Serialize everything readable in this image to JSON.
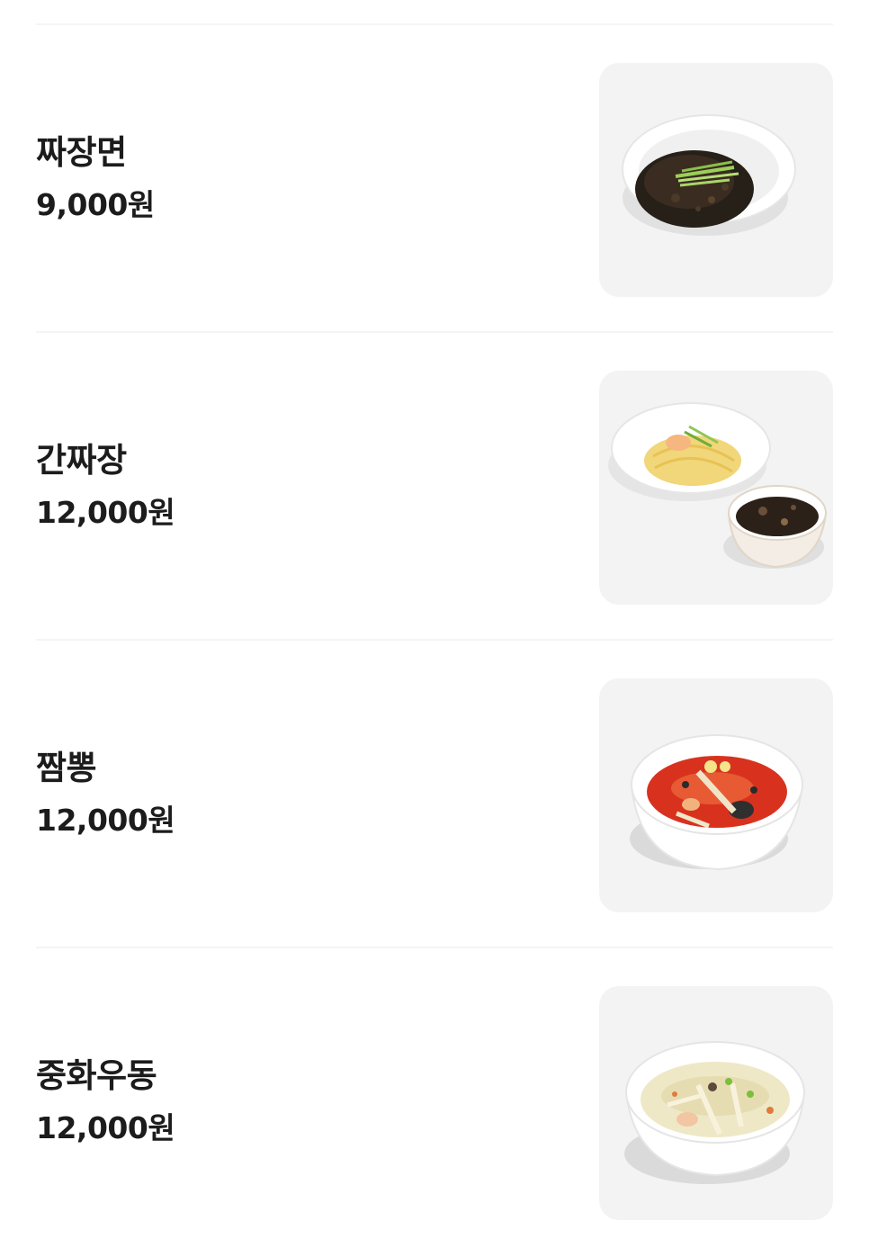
{
  "menu": {
    "items": [
      {
        "name": "짜장면",
        "price": "9,000원",
        "image": "jjajangmyeon-photo"
      },
      {
        "name": "간짜장",
        "price": "12,000원",
        "image": "ganjjajang-photo"
      },
      {
        "name": "짬뽕",
        "price": "12,000원",
        "image": "jjamppong-photo"
      },
      {
        "name": "중화우동",
        "price": "12,000원",
        "image": "junghwa-udon-photo"
      }
    ]
  },
  "colors": {
    "text": "#1c1c1c",
    "thumb_bg": "#f3f3f3",
    "divider": "#f4f4f4"
  }
}
